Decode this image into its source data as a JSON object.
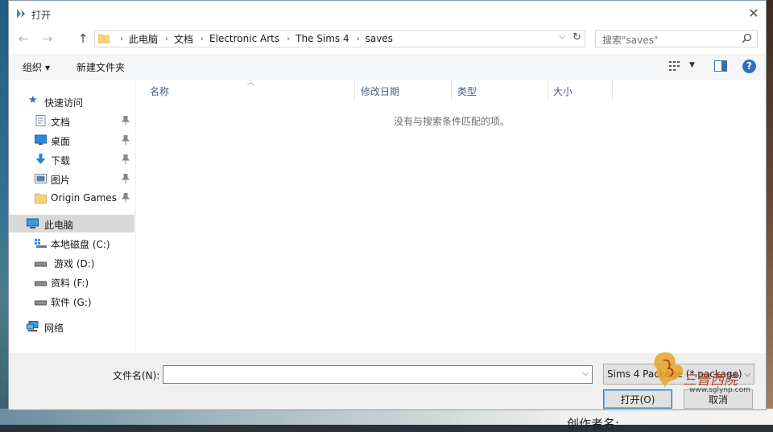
{
  "window": {
    "title": "打开",
    "close_glyph": "✕"
  },
  "nav": {
    "back_glyph": "←",
    "forward_glyph": "→",
    "up_glyph": "↑"
  },
  "address": {
    "crumbs": [
      "此电脑",
      "文档",
      "Electronic Arts",
      "The Sims 4",
      "saves"
    ],
    "separator": "›",
    "dropdown_glyph": "⌵",
    "refresh_glyph": "↻"
  },
  "search": {
    "placeholder": "搜索\"saves\""
  },
  "toolbar": {
    "organize": "组织",
    "new_folder": "新建文件夹",
    "help": "?"
  },
  "sidebar": {
    "quick_access": "快速访问",
    "quick_items": [
      {
        "label": "文档",
        "icon": "document-icon"
      },
      {
        "label": "桌面",
        "icon": "desktop-icon"
      },
      {
        "label": "下载",
        "icon": "download-icon"
      },
      {
        "label": "图片",
        "icon": "pictures-icon"
      },
      {
        "label": "Origin Games",
        "icon": "folder-icon"
      }
    ],
    "this_pc": "此电脑",
    "drives": [
      {
        "label": "本地磁盘 (C:)",
        "icon": "system-drive-icon"
      },
      {
        "label": "游戏 (D:)",
        "icon": "drive-icon"
      },
      {
        "label": "资料 (F:)",
        "icon": "drive-icon"
      },
      {
        "label": "软件 (G:)",
        "icon": "drive-icon"
      }
    ],
    "network": "网络"
  },
  "columns": [
    "名称",
    "修改日期",
    "类型",
    "大小"
  ],
  "empty_message": "没有与搜索条件匹配的项。",
  "bottom": {
    "filename_label": "文件名(N):",
    "filename_value": "",
    "file_type": "Sims 4 Package (*.package)",
    "open_button": "打开(O)",
    "cancel_button": "取消"
  },
  "watermark": {
    "text": "三晋西院",
    "url": "www.sglynp.com"
  },
  "background": {
    "text": "创作者名:"
  },
  "colors": {
    "accent": "#2f6fc4",
    "folder": "#f5d37a",
    "selection": "#d9d9d9"
  }
}
